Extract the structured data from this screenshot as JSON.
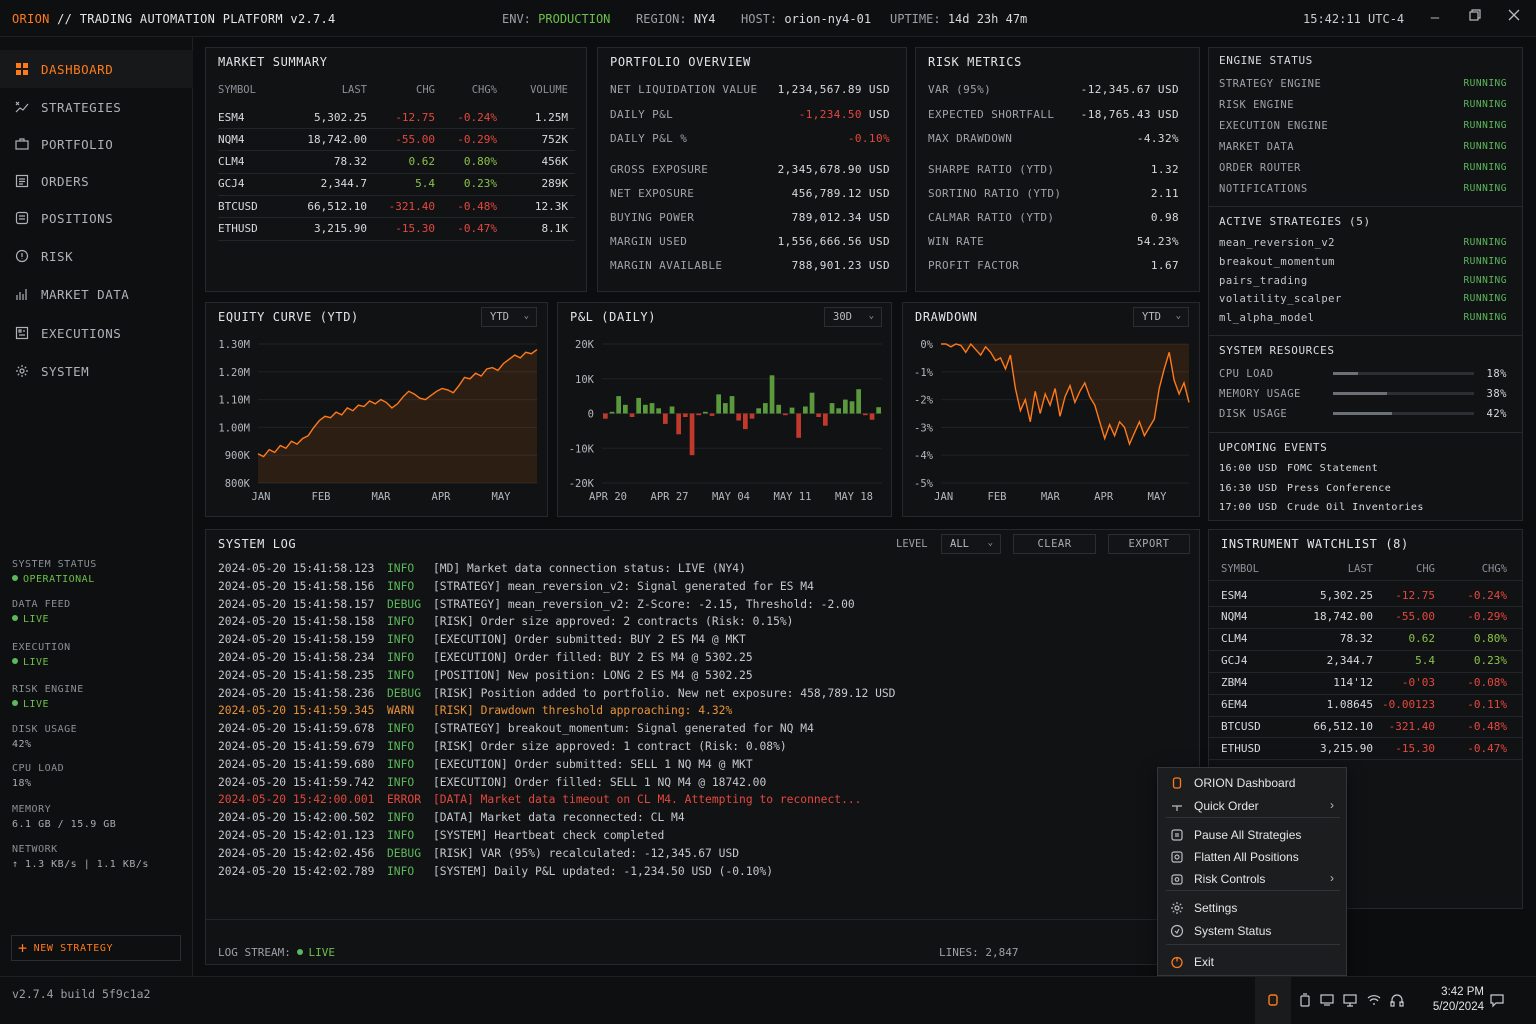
{
  "titlebar": {
    "app": "ORION",
    "title": "// TRADING AUTOMATION PLATFORM v2.7.4",
    "env_label": "ENV:",
    "env_value": "PRODUCTION",
    "region_label": "REGION:",
    "region_value": "NY4",
    "host_label": "HOST:",
    "host_value": "orion-ny4-01",
    "uptime_label": "UPTIME:",
    "uptime_value": "14d 23h 47m",
    "clock": "15:42:11 UTC-4",
    "minimize_icon": "minimize-icon",
    "maximize_icon": "restore-icon",
    "close_icon": "close-icon"
  },
  "sidebar": {
    "items": [
      {
        "label": "DASHBOARD",
        "icon": "grid-icon",
        "active": true
      },
      {
        "label": "STRATEGIES",
        "icon": "strategy-icon"
      },
      {
        "label": "PORTFOLIO",
        "icon": "briefcase-icon"
      },
      {
        "label": "ORDERS",
        "icon": "list-icon"
      },
      {
        "label": "POSITIONS",
        "icon": "positions-icon"
      },
      {
        "label": "RISK",
        "icon": "alert-icon"
      },
      {
        "label": "MARKET DATA",
        "icon": "bar-chart-icon"
      },
      {
        "label": "EXECUTIONS",
        "icon": "executions-icon"
      },
      {
        "label": "SYSTEM",
        "icon": "gear-icon"
      }
    ],
    "status": [
      {
        "label": "SYSTEM STATUS",
        "value": "OPERATIONAL",
        "live": true
      },
      {
        "label": "DATA FEED",
        "value": "LIVE",
        "live": true
      },
      {
        "label": "EXECUTION",
        "value": "LIVE",
        "live": true
      },
      {
        "label": "RISK ENGINE",
        "value": "LIVE",
        "live": true
      },
      {
        "label": "DISK USAGE",
        "value": "42%"
      },
      {
        "label": "CPU LOAD",
        "value": "18%"
      },
      {
        "label": "MEMORY",
        "value": "6.1 GB / 15.9 GB"
      },
      {
        "label": "NETWORK",
        "value": "↑ 1.3 KB/s | 1.1 KB/s"
      }
    ],
    "new_strategy": "NEW STRATEGY"
  },
  "market_summary": {
    "title": "MARKET SUMMARY",
    "headers": [
      "SYMBOL",
      "LAST",
      "CHG",
      "CHG%",
      "VOLUME"
    ],
    "rows": [
      [
        "ESM4",
        "5,302.25",
        "-12.75",
        "-0.24%",
        "1.25M",
        "dn"
      ],
      [
        "NQM4",
        "18,742.00",
        "-55.00",
        "-0.29%",
        "752K",
        "dn"
      ],
      [
        "CLM4",
        "78.32",
        "0.62",
        "0.80%",
        "456K",
        "up"
      ],
      [
        "GCJ4",
        "2,344.7",
        "5.4",
        "0.23%",
        "289K",
        "up"
      ],
      [
        "BTCUSD",
        "66,512.10",
        "-321.40",
        "-0.48%",
        "12.3K",
        "dn"
      ],
      [
        "ETHUSD",
        "3,215.90",
        "-15.30",
        "-0.47%",
        "8.1K",
        "dn"
      ]
    ]
  },
  "portfolio": {
    "title": "PORTFOLIO OVERVIEW",
    "rows": [
      {
        "k": "NET LIQUIDATION VALUE",
        "v": "1,234,567.89 USD"
      },
      {
        "k": "DAILY P&L",
        "v": "-1,234.50",
        "u": "USD",
        "neg": true
      },
      {
        "k": "DAILY P&L %",
        "v": "-0.10%",
        "neg": true
      },
      {
        "k": "GROSS EXPOSURE",
        "v": "2,345,678.90 USD"
      },
      {
        "k": "NET EXPOSURE",
        "v": "456,789.12 USD"
      },
      {
        "k": "BUYING POWER",
        "v": "789,012.34 USD"
      },
      {
        "k": "MARGIN USED",
        "v": "1,556,666.56 USD"
      },
      {
        "k": "MARGIN AVAILABLE",
        "v": "788,901.23 USD"
      }
    ]
  },
  "risk": {
    "title": "RISK METRICS",
    "rows": [
      {
        "k": "VAR (95%)",
        "v": "-12,345.67 USD"
      },
      {
        "k": "EXPECTED SHORTFALL",
        "v": "-18,765.43 USD"
      },
      {
        "k": "MAX DRAWDOWN",
        "v": "-4.32%"
      },
      {
        "k": "SHARPE RATIO (YTD)",
        "v": "1.32"
      },
      {
        "k": "SORTINO RATIO (YTD)",
        "v": "2.11"
      },
      {
        "k": "CALMAR RATIO (YTD)",
        "v": "0.98"
      },
      {
        "k": "WIN RATE",
        "v": "54.23%"
      },
      {
        "k": "PROFIT FACTOR",
        "v": "1.67"
      }
    ]
  },
  "engine": {
    "title": "ENGINE STATUS",
    "rows": [
      {
        "k": "STRATEGY ENGINE",
        "v": "RUNNING"
      },
      {
        "k": "RISK ENGINE",
        "v": "RUNNING"
      },
      {
        "k": "EXECUTION ENGINE",
        "v": "RUNNING"
      },
      {
        "k": "MARKET DATA",
        "v": "RUNNING"
      },
      {
        "k": "ORDER ROUTER",
        "v": "RUNNING"
      },
      {
        "k": "NOTIFICATIONS",
        "v": "RUNNING"
      }
    ],
    "active_title": "ACTIVE STRATEGIES (5)",
    "active": [
      {
        "k": "mean_reversion_v2",
        "v": "RUNNING"
      },
      {
        "k": "breakout_momentum",
        "v": "RUNNING"
      },
      {
        "k": "pairs_trading",
        "v": "RUNNING"
      },
      {
        "k": "volatility_scalper",
        "v": "RUNNING"
      },
      {
        "k": "ml_alpha_model",
        "v": "RUNNING"
      }
    ],
    "resources_title": "SYSTEM RESOURCES",
    "resources": [
      {
        "k": "CPU LOAD",
        "v": "18%",
        "pct": 18
      },
      {
        "k": "MEMORY USAGE",
        "v": "38%",
        "pct": 38
      },
      {
        "k": "DISK USAGE",
        "v": "42%",
        "pct": 42
      }
    ],
    "events_title": "UPCOMING EVENTS",
    "events": [
      {
        "t": "16:00 USD",
        "e": "FOMC Statement"
      },
      {
        "t": "16:30 USD",
        "e": "Press Conference"
      },
      {
        "t": "17:00 USD",
        "e": "Crude Oil Inventories"
      }
    ]
  },
  "charts": {
    "equity": {
      "title": "EQUITY CURVE (YTD)",
      "range": "YTD"
    },
    "pnl": {
      "title": "P&L (DAILY)",
      "range": "30D"
    },
    "drawdown": {
      "title": "DRAWDOWN",
      "range": "YTD"
    }
  },
  "chart_data": [
    {
      "type": "area",
      "title": "EQUITY CURVE (YTD)",
      "x_ticks": [
        "JAN",
        "FEB",
        "MAR",
        "APR",
        "MAY"
      ],
      "y_ticks": [
        "1.30M",
        "1.20M",
        "1.10M",
        "1.00M",
        "900K",
        "800K"
      ],
      "ylim": [
        800000,
        1300000
      ],
      "x": [
        0,
        3,
        6,
        9,
        12,
        15,
        18,
        21,
        24,
        27,
        30,
        33,
        36,
        39,
        42,
        45,
        48,
        51,
        54,
        57,
        60,
        63,
        66,
        69,
        72,
        75,
        78,
        81,
        84,
        87,
        90,
        93,
        96,
        99,
        102,
        105,
        108,
        111,
        114,
        117,
        120,
        123,
        126,
        129,
        132,
        135,
        138,
        141,
        144,
        147,
        150
      ],
      "values": [
        905000,
        895000,
        920000,
        910000,
        935000,
        925000,
        950000,
        940000,
        960000,
        970000,
        1000000,
        1025000,
        1040000,
        1035000,
        1055000,
        1045000,
        1070000,
        1060000,
        1080000,
        1075000,
        1095000,
        1085000,
        1100000,
        1090000,
        1070000,
        1085000,
        1110000,
        1130000,
        1120000,
        1105000,
        1100000,
        1115000,
        1130000,
        1140000,
        1135000,
        1125000,
        1150000,
        1180000,
        1175000,
        1195000,
        1185000,
        1210000,
        1215000,
        1205000,
        1230000,
        1245000,
        1260000,
        1250000,
        1270000,
        1265000,
        1280000
      ]
    },
    {
      "type": "bar",
      "title": "P&L (DAILY)",
      "x_ticks": [
        "APR 20",
        "APR 27",
        "MAY 04",
        "MAY 11",
        "MAY 18"
      ],
      "y_ticks": [
        "20K",
        "10K",
        "0",
        "-10K",
        "-20K"
      ],
      "ylim": [
        -20000,
        20000
      ],
      "values": [
        -1500,
        500,
        5000,
        2500,
        -1000,
        4500,
        2500,
        3000,
        1500,
        -3000,
        2000,
        -6000,
        -1000,
        -12000,
        -500,
        500,
        -700,
        5500,
        3000,
        5000,
        -2000,
        -4500,
        -1500,
        1500,
        3000,
        11000,
        2500,
        -500,
        1700,
        -7000,
        2000,
        6000,
        -1000,
        -3500,
        3000,
        1500,
        4000,
        3500,
        7000,
        -500,
        -1800,
        1800
      ]
    },
    {
      "type": "area",
      "title": "DRAWDOWN",
      "x_ticks": [
        "JAN",
        "FEB",
        "MAR",
        "APR",
        "MAY"
      ],
      "y_ticks": [
        "0%",
        "-1%",
        "-2%",
        "-3%",
        "-4%",
        "-5%"
      ],
      "ylim": [
        -5,
        0
      ],
      "x": [
        0,
        3,
        6,
        9,
        12,
        15,
        18,
        21,
        24,
        27,
        30,
        33,
        36,
        39,
        42,
        45,
        48,
        51,
        54,
        57,
        60,
        63,
        66,
        69,
        72,
        75,
        78,
        81,
        84,
        87,
        90,
        93,
        96,
        99,
        102,
        105,
        108,
        111,
        114,
        117,
        120,
        123,
        126,
        129,
        132,
        135,
        138,
        141,
        144,
        147,
        150
      ],
      "values": [
        0,
        0,
        -0.1,
        0,
        -0.05,
        -0.3,
        0,
        -0.2,
        -0.4,
        -0.1,
        -0.3,
        -0.6,
        -0.5,
        -0.9,
        -0.4,
        -1.6,
        -2.4,
        -2.0,
        -2.8,
        -1.7,
        -2.5,
        -1.8,
        -2.2,
        -1.6,
        -2.6,
        -1.9,
        -1.5,
        -2.1,
        -1.7,
        -1.4,
        -1.9,
        -2.2,
        -2.8,
        -3.4,
        -2.9,
        -3.3,
        -2.8,
        -3.0,
        -3.6,
        -3.2,
        -2.8,
        -3.3,
        -3.0,
        -2.7,
        -1.6,
        -0.9,
        -0.3,
        -1.3,
        -1.8,
        -1.4,
        -2.1
      ]
    }
  ],
  "log": {
    "title": "SYSTEM LOG",
    "level_label": "LEVEL",
    "level_value": "ALL",
    "clear": "CLEAR",
    "export": "EXPORT",
    "lines": [
      {
        "ts": "2024-05-20 15:41:58.123",
        "lvl": "INFO",
        "msg": "[MD] Market data connection status: LIVE (NY4)"
      },
      {
        "ts": "2024-05-20 15:41:58.156",
        "lvl": "INFO",
        "msg": "[STRATEGY] mean_reversion_v2: Signal generated for ES M4"
      },
      {
        "ts": "2024-05-20 15:41:58.157",
        "lvl": "DEBUG",
        "msg": "[STRATEGY] mean_reversion_v2: Z-Score: -2.15, Threshold: -2.00"
      },
      {
        "ts": "2024-05-20 15:41:58.158",
        "lvl": "INFO",
        "msg": "[RISK] Order size approved: 2 contracts (Risk: 0.15%)"
      },
      {
        "ts": "2024-05-20 15:41:58.159",
        "lvl": "INFO",
        "msg": "[EXECUTION] Order submitted: BUY 2 ES M4 @ MKT"
      },
      {
        "ts": "2024-05-20 15:41:58.234",
        "lvl": "INFO",
        "msg": "[EXECUTION] Order filled: BUY 2 ES M4 @ 5302.25"
      },
      {
        "ts": "2024-05-20 15:41:58.235",
        "lvl": "INFO",
        "msg": "[POSITION] New position: LONG 2 ES M4 @ 5302.25"
      },
      {
        "ts": "2024-05-20 15:41:58.236",
        "lvl": "DEBUG",
        "msg": "[RISK] Position added to portfolio. New net exposure: 458,789.12 USD"
      },
      {
        "ts": "2024-05-20 15:41:59.345",
        "lvl": "WARN",
        "msg": "[RISK] Drawdown threshold approaching: 4.32%"
      },
      {
        "ts": "2024-05-20 15:41:59.678",
        "lvl": "INFO",
        "msg": "[STRATEGY] breakout_momentum: Signal generated for NQ M4"
      },
      {
        "ts": "2024-05-20 15:41:59.679",
        "lvl": "INFO",
        "msg": "[RISK] Order size approved: 1 contract (Risk: 0.08%)"
      },
      {
        "ts": "2024-05-20 15:41:59.680",
        "lvl": "INFO",
        "msg": "[EXECUTION] Order submitted: SELL 1 NQ M4 @ MKT"
      },
      {
        "ts": "2024-05-20 15:41:59.742",
        "lvl": "INFO",
        "msg": "[EXECUTION] Order filled: SELL 1 NQ M4 @ 18742.00"
      },
      {
        "ts": "2024-05-20 15:42:00.001",
        "lvl": "ERROR",
        "msg": "[DATA] Market data timeout on CL M4. Attempting to reconnect..."
      },
      {
        "ts": "2024-05-20 15:42:00.502",
        "lvl": "INFO",
        "msg": "[DATA] Market data reconnected: CL M4"
      },
      {
        "ts": "2024-05-20 15:42:01.123",
        "lvl": "INFO",
        "msg": "[SYSTEM] Heartbeat check completed"
      },
      {
        "ts": "2024-05-20 15:42:02.456",
        "lvl": "DEBUG",
        "msg": "[RISK] VAR (95%) recalculated: -12,345.67 USD"
      },
      {
        "ts": "2024-05-20 15:42:02.789",
        "lvl": "INFO",
        "msg": "[SYSTEM] Daily P&L updated: -1,234.50 USD (-0.10%)"
      }
    ],
    "stream_label": "LOG STREAM:",
    "stream_value": "LIVE",
    "lines_count": "LINES: 2,847"
  },
  "watchlist": {
    "title": "INSTRUMENT WATCHLIST (8)",
    "headers": [
      "SYMBOL",
      "LAST",
      "CHG",
      "CHG%"
    ],
    "rows": [
      [
        "ESM4",
        "5,302.25",
        "-12.75",
        "-0.24%",
        "dn"
      ],
      [
        "NQM4",
        "18,742.00",
        "-55.00",
        "-0.29%",
        "dn"
      ],
      [
        "CLM4",
        "78.32",
        "0.62",
        "0.80%",
        "up"
      ],
      [
        "GCJ4",
        "2,344.7",
        "5.4",
        "0.23%",
        "up"
      ],
      [
        "ZBM4",
        "114'12",
        "-0'03",
        "-0.08%",
        "dn"
      ],
      [
        "6EM4",
        "1.08645",
        "-0.00123",
        "-0.11%",
        "dn"
      ],
      [
        "BTCUSD",
        "66,512.10",
        "-321.40",
        "-0.48%",
        "dn"
      ],
      [
        "ETHUSD",
        "3,215.90",
        "-15.30",
        "-0.47%",
        "dn"
      ]
    ]
  },
  "context_menu": {
    "items": [
      {
        "label": "ORION Dashboard",
        "icon": "orion-icon"
      },
      {
        "label": "Quick Order",
        "icon": "quick-order-icon",
        "sub": true
      },
      {
        "label": "Pause All Strategies",
        "icon": "pause-icon"
      },
      {
        "label": "Flatten All Positions",
        "icon": "flatten-icon"
      },
      {
        "label": "Risk Controls",
        "icon": "risk-controls-icon",
        "sub": true
      },
      {
        "label": "Settings",
        "icon": "gear-icon"
      },
      {
        "label": "System Status",
        "icon": "status-icon"
      },
      {
        "label": "Exit",
        "icon": "power-icon"
      }
    ]
  },
  "taskbar": {
    "build": "v2.7.4 build 5f9c1a2",
    "time": "3:42 PM",
    "date": "5/20/2024"
  },
  "colors": {
    "accent": "#ff7a1a",
    "up": "#8bc34a",
    "down": "#e5483e",
    "running": "#5cb85c",
    "warn": "#e8923a"
  }
}
